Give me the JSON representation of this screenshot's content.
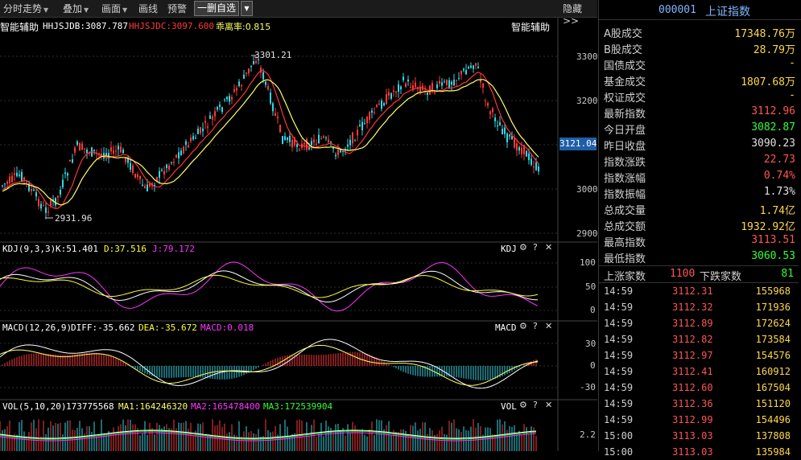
{
  "toolbar": {
    "items": [
      "分时走势",
      "叠加",
      "画面",
      "画线",
      "预警"
    ],
    "button": "一删自选",
    "hide_label": "隐藏>>"
  },
  "main_chart": {
    "header_label": "智能辅助",
    "jdb_label": "HHJSJDB:3087.787",
    "jdc_label": "HHJSJDC:3097.600",
    "ratio_label": "乖离率:0.815",
    "right_label": "智能辅助",
    "high_annotation": "3301.21",
    "low_annotation": "2931.96",
    "current_price_tag": "3121.04",
    "y_ticks": [
      "3300",
      "3200",
      "3100",
      "3000",
      "2900"
    ]
  },
  "kdj_panel": {
    "title": "KDJ(9,3,3)",
    "k_label": "K:51.401",
    "d_label": "D:37.516",
    "j_label": "J:79.172",
    "right_label": "KDJ",
    "y_ticks": [
      "100",
      "50",
      "0"
    ]
  },
  "macd_panel": {
    "title": "MACD(12,26,9)",
    "diff_label": "DIFF:-35.662",
    "dea_label": "DEA:-35.672",
    "macd_label": "MACD:0.018",
    "right_label": "MACD",
    "y_ticks": [
      "30",
      "0",
      "-30"
    ]
  },
  "vol_panel": {
    "title": "VOL(5,10,20)",
    "vol_label": "173775568",
    "ma1_label": "MA1:164246320",
    "ma2_label": "MA2:165478400",
    "ma3_label": "MA3:172539904",
    "right_label": "VOL",
    "y_ticks": [
      "2.2"
    ]
  },
  "colors": {
    "up": "#ff3a3a",
    "down": "#36d6e6",
    "ma_yellow": "#ffff66",
    "ma_red": "#ff3333",
    "kdj_k": "#ffffff",
    "kdj_d": "#ffff33",
    "kdj_j": "#ff33ff",
    "vol_ma1": "#ffffff",
    "vol_ma2": "#ff33ff",
    "vol_ma3": "#33ff33",
    "accent_blue": "#7fb6ff",
    "red_text": "#ff5555",
    "green_text": "#33ff33",
    "yellow_text": "#ffd84a"
  },
  "right_panel": {
    "code": "000001",
    "name": "上证指数",
    "stats": [
      {
        "label": "A股成交",
        "value": "17348.76万",
        "color": "yellow"
      },
      {
        "label": "B股成交",
        "value": "28.79万",
        "color": "yellow"
      },
      {
        "label": "国债成交",
        "value": "-",
        "color": "yellow"
      },
      {
        "label": "基金成交",
        "value": "1807.68万",
        "color": "yellow"
      },
      {
        "label": "权证成交",
        "value": "-",
        "color": "yellow"
      },
      {
        "label": "最新指数",
        "value": "3112.96",
        "color": "red"
      },
      {
        "label": "今日开盘",
        "value": "3082.87",
        "color": "green"
      },
      {
        "label": "昨日收盘",
        "value": "3090.23",
        "color": "white"
      },
      {
        "label": "指数涨跌",
        "value": "22.73",
        "color": "red"
      },
      {
        "label": "指数涨幅",
        "value": "0.74%",
        "color": "red"
      },
      {
        "label": "指数振幅",
        "value": "1.73%",
        "color": "white"
      },
      {
        "label": "总成交量",
        "value": "1.74亿",
        "color": "yellow"
      },
      {
        "label": "总成交额",
        "value": "1932.92亿",
        "color": "yellow"
      },
      {
        "label": "最高指数",
        "value": "3113.51",
        "color": "red"
      },
      {
        "label": "最低指数",
        "value": "3060.53",
        "color": "green"
      }
    ],
    "up_label": "上涨家数",
    "up_count": "1100",
    "down_label": "下跌家数",
    "down_count": "81",
    "ticks": [
      {
        "time": "14:59",
        "price": "3112.31",
        "volume": "155968"
      },
      {
        "time": "14:59",
        "price": "3112.32",
        "volume": "171936"
      },
      {
        "time": "14:59",
        "price": "3112.89",
        "volume": "172624"
      },
      {
        "time": "14:59",
        "price": "3112.82",
        "volume": "173584"
      },
      {
        "time": "14:59",
        "price": "3112.97",
        "volume": "154576"
      },
      {
        "time": "14:59",
        "price": "3112.41",
        "volume": "160912"
      },
      {
        "time": "14:59",
        "price": "3112.60",
        "volume": "167504"
      },
      {
        "time": "14:59",
        "price": "3112.36",
        "volume": "151120"
      },
      {
        "time": "14:59",
        "price": "3112.99",
        "volume": "154496"
      },
      {
        "time": "15:00",
        "price": "3113.03",
        "volume": "137808"
      },
      {
        "time": "15:00",
        "price": "3113.03",
        "volume": "135984"
      }
    ]
  }
}
